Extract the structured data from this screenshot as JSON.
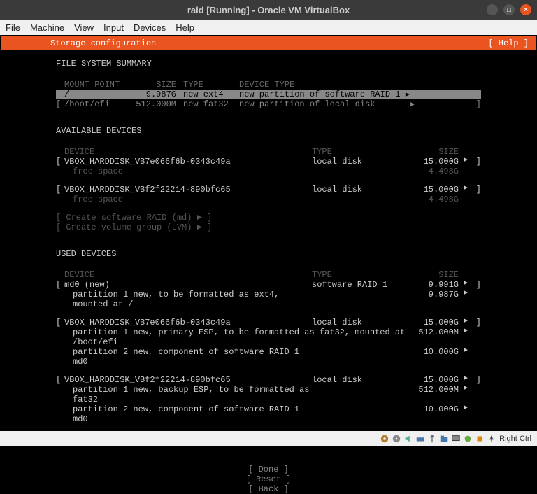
{
  "window": {
    "title": "raid [Running] - Oracle VM VirtualBox"
  },
  "menubar": [
    "File",
    "Machine",
    "View",
    "Input",
    "Devices",
    "Help"
  ],
  "header": {
    "title": "Storage configuration",
    "help": "[ Help ]"
  },
  "fs_summary": {
    "title": "FILE SYSTEM SUMMARY",
    "headers": {
      "mount": "MOUNT POINT",
      "size": "SIZE",
      "type": "TYPE",
      "dtype": "DEVICE TYPE"
    },
    "rows": [
      {
        "mount": "/",
        "size": "9.987G",
        "type": "new ext4",
        "dtype": "new partition of software RAID 1",
        "selected": true
      },
      {
        "mount": "/boot/efi",
        "size": "512.000M",
        "type": "new fat32",
        "dtype": "new partition of local disk",
        "selected": false
      }
    ]
  },
  "available": {
    "title": "AVAILABLE DEVICES",
    "headers": {
      "device": "DEVICE",
      "type": "TYPE",
      "size": "SIZE"
    },
    "devices": [
      {
        "name": "VBOX_HARDDISK_VB7e066f6b-0343c49a",
        "type": "local disk",
        "size": "15.000G",
        "free_label": "free space",
        "free": "4.498G"
      },
      {
        "name": "VBOX_HARDDISK_VBf2f22214-890bfc65",
        "type": "local disk",
        "size": "15.000G",
        "free_label": "free space",
        "free": "4.498G"
      }
    ],
    "create_raid": "[ Create software RAID (md) ► ]",
    "create_lvm": "[ Create volume group (LVM) ► ]"
  },
  "used": {
    "title": "USED DEVICES",
    "headers": {
      "device": "DEVICE",
      "type": "TYPE",
      "size": "SIZE"
    },
    "md0": {
      "name": "md0 (new)",
      "type": "software RAID 1",
      "size": "9.991G",
      "p1": "partition 1  new, to be formatted as ext4, mounted at /",
      "p1_size": "9.987G"
    },
    "disk1": {
      "name": "VBOX_HARDDISK_VB7e066f6b-0343c49a",
      "type": "local disk",
      "size": "15.000G",
      "p1": "partition 1  new, primary ESP, to be formatted as fat32, mounted at /boot/efi",
      "p1_size": "512.000M",
      "p2": "partition 2  new, component of software RAID 1 md0",
      "p2_size": "10.000G"
    },
    "disk2": {
      "name": "VBOX_HARDDISK_VBf2f22214-890bfc65",
      "type": "local disk",
      "size": "15.000G",
      "p1": "partition 1  new, backup ESP, to be formatted as fat32",
      "p1_size": "512.000M",
      "p2": "partition 2  new, component of software RAID 1 md0",
      "p2_size": "10.000G"
    }
  },
  "buttons": {
    "done": "[ Done       ]",
    "reset": "[ Reset      ]",
    "back": "[ Back       ]"
  },
  "statusbar": {
    "host_key": "Right Ctrl"
  }
}
